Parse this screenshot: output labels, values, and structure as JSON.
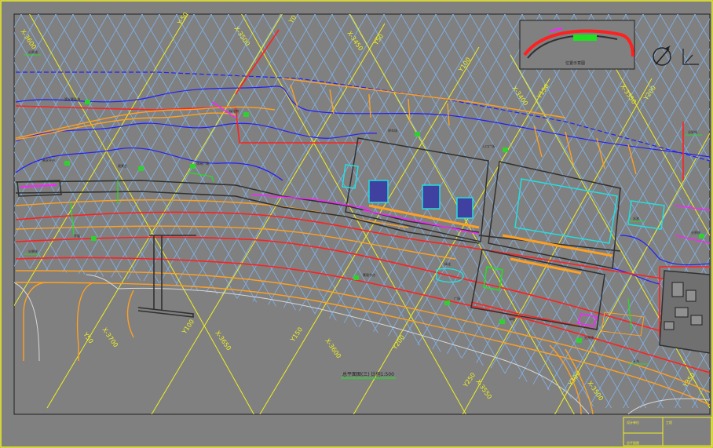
{
  "colors": {
    "background": "#808080",
    "frame": "#f0f020",
    "grid_blue": "#7fb3ee",
    "grid_yellow": "#f0f020",
    "red_line": "#ff2020",
    "orange_line": "#ffa020",
    "blue_contour": "#2020ff",
    "dark_line": "#303030",
    "cyan": "#20e0e0",
    "magenta": "#ff20ff",
    "green": "#20e020",
    "label_green": "#30d030"
  },
  "grid_labels": [
    {
      "id": "x3600-top",
      "text": "X-3600"
    },
    {
      "id": "y50-top",
      "text": "Y-50"
    },
    {
      "id": "x3500-top",
      "text": "X-3500"
    },
    {
      "id": "y0-top",
      "text": "Y0"
    },
    {
      "id": "x3450-top",
      "text": "X-3450"
    },
    {
      "id": "y50b-top",
      "text": "Y50"
    },
    {
      "id": "y100-top",
      "text": "Y100"
    },
    {
      "id": "x3400-top",
      "text": "X-3400"
    },
    {
      "id": "y150-top",
      "text": "Y150"
    },
    {
      "id": "x3350-top",
      "text": "X-3350"
    },
    {
      "id": "y200-top",
      "text": "Y200"
    },
    {
      "id": "y50-bot",
      "text": "Y50"
    },
    {
      "id": "x3700-bot",
      "text": "X-3700"
    },
    {
      "id": "y100-bot",
      "text": "Y100"
    },
    {
      "id": "x3650-bot",
      "text": "X-3650"
    },
    {
      "id": "y150-bot",
      "text": "Y150"
    },
    {
      "id": "x3600-bot",
      "text": "X-3600"
    },
    {
      "id": "y200-bot",
      "text": "Y200"
    },
    {
      "id": "y250-bot",
      "text": "Y250"
    },
    {
      "id": "x3550-bot",
      "text": "X-3550"
    },
    {
      "id": "y300-bot",
      "text": "Y300"
    },
    {
      "id": "x3500-bot",
      "text": "X-3500"
    },
    {
      "id": "y350-bot",
      "text": "Y350"
    }
  ],
  "area_labels": [
    {
      "id": "a1",
      "text": "分界线"
    },
    {
      "id": "a2",
      "text": "滨水景观带"
    },
    {
      "id": "a3",
      "text": "绿化带"
    },
    {
      "id": "a4",
      "text": "亲水平台"
    },
    {
      "id": "a5",
      "text": "观景台"
    },
    {
      "id": "a6",
      "text": "休闲广场"
    },
    {
      "id": "a7",
      "text": "停车场"
    },
    {
      "id": "a8",
      "text": "入口广场"
    },
    {
      "id": "a9",
      "text": "分界线"
    },
    {
      "id": "a10",
      "text": "分界线"
    },
    {
      "id": "a11",
      "text": "步道"
    },
    {
      "id": "a12",
      "text": "景观节点"
    },
    {
      "id": "a13",
      "text": "广场"
    },
    {
      "id": "a14",
      "text": "绿地"
    },
    {
      "id": "a15",
      "text": "分界线"
    },
    {
      "id": "a16",
      "text": "平台"
    },
    {
      "id": "a17",
      "text": "分界线"
    },
    {
      "id": "a18",
      "text": "水池"
    },
    {
      "id": "a19",
      "text": "绿化"
    }
  ],
  "key_plan_label": "位置示意图",
  "drawing_title": "总平面图(三) 比例1:500",
  "title_block": {
    "cell_1": "设计单位",
    "cell_2": "工程",
    "cell_3": "总平面图"
  }
}
